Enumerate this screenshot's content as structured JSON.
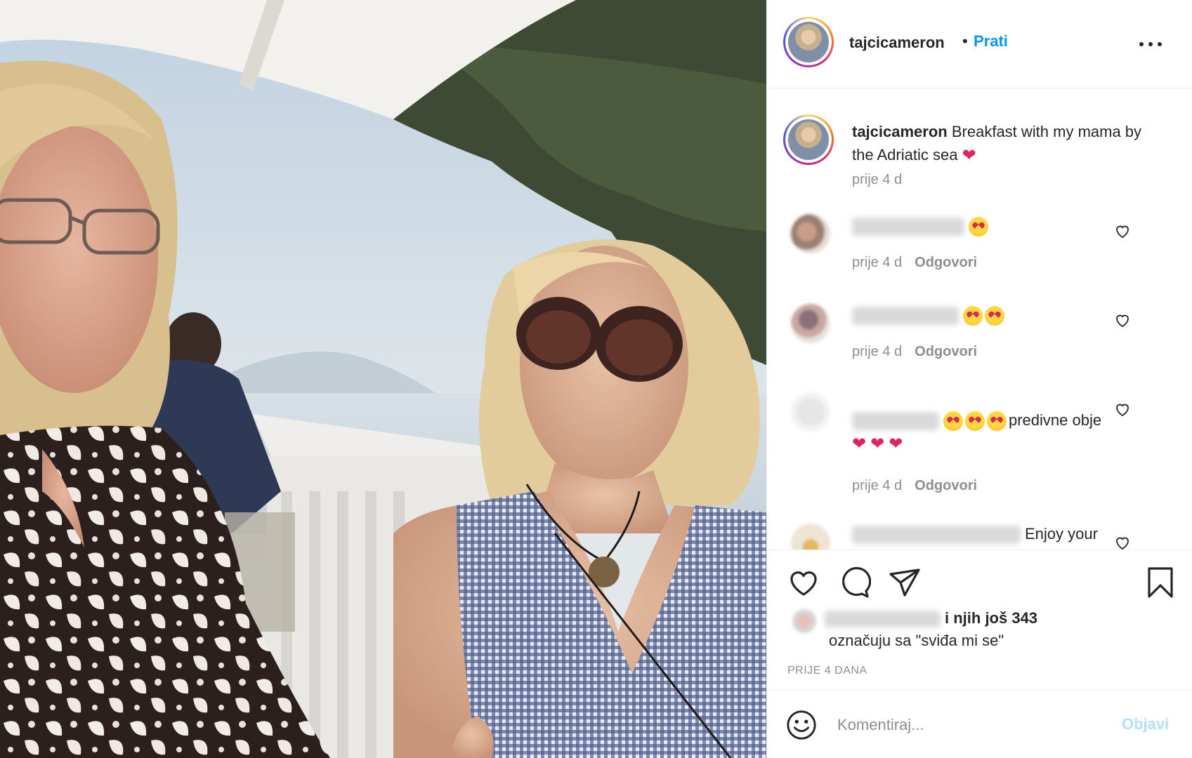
{
  "post": {
    "username": "tajcicameron",
    "separator": "•",
    "follow_label": "Prati",
    "more_icon": "more-options-icon"
  },
  "caption": {
    "username": "tajcicameron",
    "text": "Breakfast with my mama by the Adriatic sea",
    "emoji": "❤",
    "time": "prije 4 d"
  },
  "comments": [
    {
      "emojis": 1,
      "text": "",
      "time": "prije 4 d",
      "reply": "Odgovori"
    },
    {
      "emojis": 2,
      "text": "",
      "time": "prije 4 d",
      "reply": "Odgovori"
    },
    {
      "emojis": 3,
      "text": "predivne obje",
      "hearts": "❤❤❤",
      "time": "prije 4 d",
      "reply": "Odgovori"
    },
    {
      "emojis": 0,
      "text": "Enjoy your"
    }
  ],
  "likes": {
    "suffix": "i njih još 343",
    "line2": "označuju sa \"sviđa mi se\"",
    "timestamp": "PRIJE 4 DANA"
  },
  "add_comment": {
    "placeholder": "Komentiraj...",
    "post_label": "Objavi"
  },
  "colors": {
    "accent": "#0095f6",
    "muted": "#8e8e8e",
    "post_disabled": "#b2dffc"
  }
}
